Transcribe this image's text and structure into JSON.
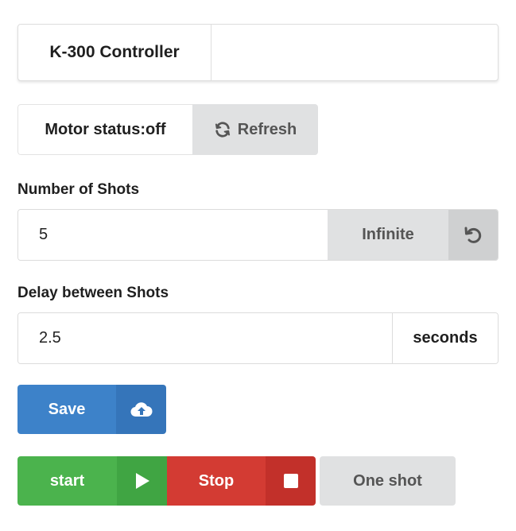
{
  "header": {
    "title": "K-300 Controller"
  },
  "motor": {
    "status_label": "Motor status:off",
    "refresh_label": "Refresh"
  },
  "shots": {
    "label": "Number of Shots",
    "value": "5",
    "infinite_label": "Infinite"
  },
  "delay": {
    "label": "Delay between Shots",
    "value": "2.5",
    "unit": "seconds"
  },
  "actions": {
    "save_label": "Save",
    "start_label": "start",
    "stop_label": "Stop",
    "one_shot_label": "One shot"
  },
  "colors": {
    "save": "#3d82c9",
    "save_icon_bg": "#3575ba",
    "start": "#4bb34d",
    "start_icon_bg": "#40a543",
    "stop": "#d33b33",
    "stop_icon_bg": "#c2302a",
    "neutral": "#e0e1e2"
  },
  "icons": {
    "refresh": "refresh-icon",
    "reset": "undo-icon",
    "save": "cloud-upload-icon",
    "start": "play-icon",
    "stop": "stop-square-icon"
  }
}
